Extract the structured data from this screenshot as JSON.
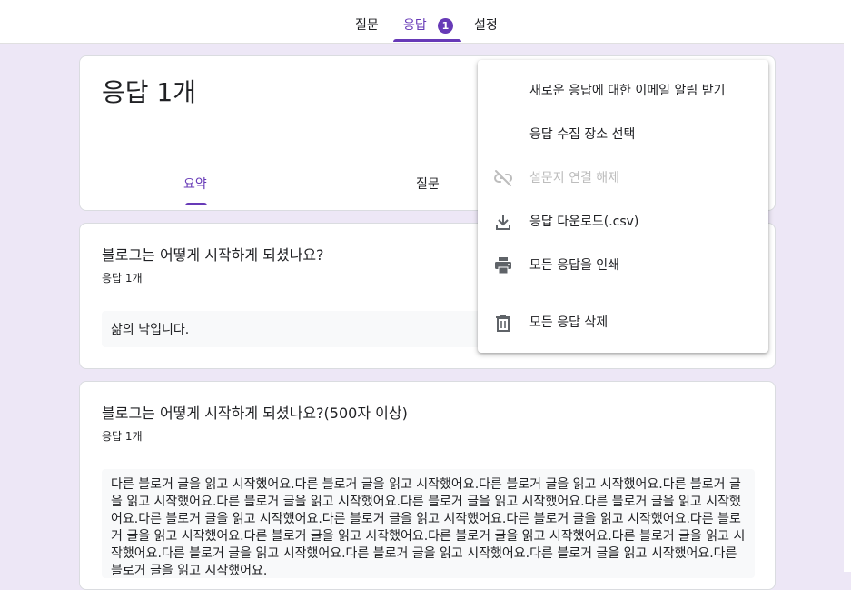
{
  "tabs": [
    {
      "label": "질문"
    },
    {
      "label": "응답"
    },
    {
      "label": "설정"
    }
  ],
  "badge_count": "1",
  "summary": {
    "title": "응답 1개",
    "tabs": [
      {
        "label": "요약"
      },
      {
        "label": "질문"
      }
    ]
  },
  "questions": [
    {
      "title": "블로그는 어떻게 시작하게 되셨나요?",
      "count": "응답 1개",
      "answer": "삶의 낙입니다."
    },
    {
      "title": "블로그는 어떻게 시작하게 되셨나요?(500자 이상)",
      "count": "응답 1개",
      "answer": "다른 블로거 글을 읽고 시작했어요.다른 블로거 글을 읽고 시작했어요.다른 블로거 글을 읽고 시작했어요.다른 블로거 글을 읽고 시작했어요.다른 블로거 글을 읽고 시작했어요.다른 블로거 글을 읽고 시작했어요.다른 블로거 글을 읽고 시작했어요.다른 블로거 글을 읽고 시작했어요.다른 블로거 글을 읽고 시작했어요.다른 블로거 글을 읽고 시작했어요.다른 블로거 글을 읽고 시작했어요.다른 블로거 글을 읽고 시작했어요.다른 블로거 글을 읽고 시작했어요.다른 블로거 글을 읽고 시작했어요.다른 블로거 글을 읽고 시작했어요.다른 블로거 글을 읽고 시작했어요.다른 블로거 글을 읽고 시작했어요.다른 블로거 글을 읽고 시작했어요."
    }
  ],
  "menu": {
    "items": [
      {
        "label": "새로운 응답에 대한 이메일 알림 받기",
        "icon": "none"
      },
      {
        "label": "응답 수집 장소 선택",
        "icon": "none"
      },
      {
        "label": "설문지 연결 해제",
        "icon": "link-off-icon",
        "disabled": true
      },
      {
        "label": "응답 다운로드(.csv)",
        "icon": "download-icon"
      },
      {
        "label": "모든 응답을 인쇄",
        "icon": "print-icon"
      },
      {
        "label": "모든 응답 삭제",
        "icon": "trash-icon"
      }
    ]
  },
  "colors": {
    "accent": "#673ab7",
    "background": "#ede7f6",
    "disabled": "#bdbdbd"
  }
}
